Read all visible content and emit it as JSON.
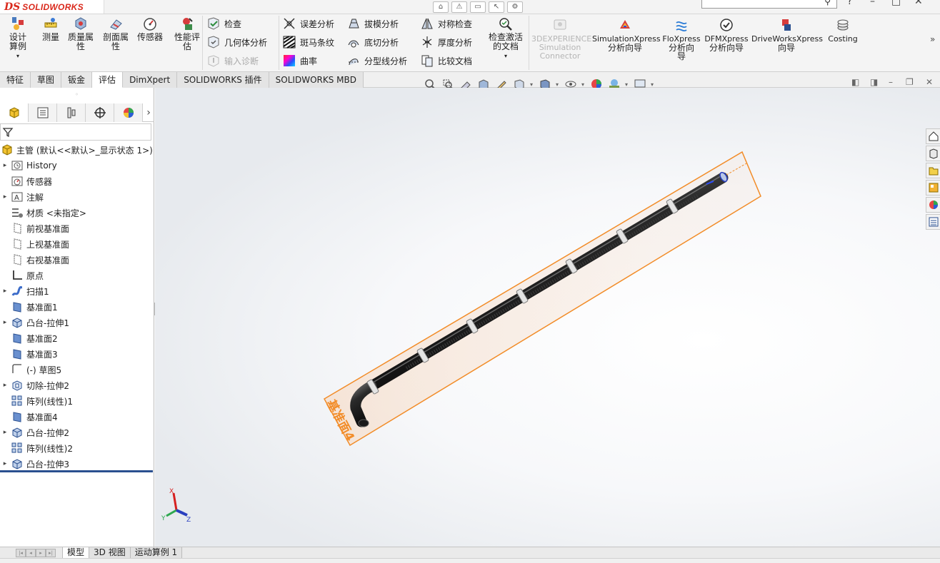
{
  "app": {
    "brand_mark": "DS",
    "brand_name": "SOLIDWORKS"
  },
  "ribbon": {
    "design_study": "设计算例",
    "measure": "测量",
    "mass_properties": "质量属性",
    "section_properties": "剖面属性",
    "sensors": "传感器",
    "performance_eval": "性能评估",
    "check": "检查",
    "geometry_analysis": "几何体分析",
    "import_diagnostics": "输入诊断",
    "deviation_analysis": "误差分析",
    "zebra_stripes": "斑马条纹",
    "curvature": "曲率",
    "draft_analysis": "拔模分析",
    "undercut_analysis": "底切分析",
    "parting_line_analysis": "分型线分析",
    "symmetry_check": "对称检查",
    "thickness_analysis": "厚度分析",
    "compare_documents": "比较文档",
    "check_active_doc": "检查激活的文档",
    "exp_line1": "3DEXPERIENCE",
    "exp_line2": "Simulation",
    "exp_line3": "Connector",
    "simxpress_1": "SimulationXpress",
    "simxpress_2": "分析向导",
    "floxpress_1": "FloXpress",
    "floxpress_2": "分析向",
    "floxpress_3": "导",
    "dfmxpress_1": "DFMXpress",
    "dfmxpress_2": "分析向导",
    "driveworks_1": "DriveWorksXpress",
    "driveworks_2": "向导",
    "costing": "Costing"
  },
  "tabs": [
    "特征",
    "草图",
    "钣金",
    "评估",
    "DimXpert",
    "SOLIDWORKS 插件",
    "SOLIDWORKS MBD"
  ],
  "active_tab": "评估",
  "feature_tree": {
    "root": "主管 (默认<<默认>_显示状态 1>)",
    "items": [
      {
        "label": "History",
        "expandable": true,
        "icon": "history-icon"
      },
      {
        "label": "传感器",
        "expandable": false,
        "icon": "sensor-icon"
      },
      {
        "label": "注解",
        "expandable": true,
        "icon": "annotation-icon"
      },
      {
        "label": "材质 <未指定>",
        "expandable": false,
        "icon": "material-icon"
      },
      {
        "label": "前视基准面",
        "expandable": false,
        "icon": "plane-icon"
      },
      {
        "label": "上视基准面",
        "expandable": false,
        "icon": "plane-icon"
      },
      {
        "label": "右视基准面",
        "expandable": false,
        "icon": "plane-icon"
      },
      {
        "label": "原点",
        "expandable": false,
        "icon": "origin-icon"
      },
      {
        "label": "扫描1",
        "expandable": true,
        "icon": "sweep-icon"
      },
      {
        "label": "基准面1",
        "expandable": false,
        "icon": "ref-plane-icon"
      },
      {
        "label": "凸台-拉伸1",
        "expandable": true,
        "icon": "extrude-icon"
      },
      {
        "label": "基准面2",
        "expandable": false,
        "icon": "ref-plane-icon"
      },
      {
        "label": "基准面3",
        "expandable": false,
        "icon": "ref-plane-icon"
      },
      {
        "label": "(-) 草图5",
        "expandable": false,
        "icon": "sketch-icon"
      },
      {
        "label": "切除-拉伸2",
        "expandable": true,
        "icon": "cut-extrude-icon"
      },
      {
        "label": "阵列(线性)1",
        "expandable": false,
        "icon": "pattern-icon"
      },
      {
        "label": "基准面4",
        "expandable": false,
        "icon": "ref-plane-icon"
      },
      {
        "label": "凸台-拉伸2",
        "expandable": true,
        "icon": "extrude-icon"
      },
      {
        "label": "阵列(线性)2",
        "expandable": false,
        "icon": "pattern-icon"
      },
      {
        "label": "凸台-拉伸3",
        "expandable": true,
        "icon": "extrude-icon"
      }
    ]
  },
  "viewport": {
    "plane_label": "基准面4",
    "plane_color": "#f28c28",
    "triad": {
      "x": "X",
      "y": "Y",
      "z": "Z"
    }
  },
  "bottom_tabs": [
    "模型",
    "3D 视图",
    "运动算例 1"
  ],
  "active_bottom_tab": "模型",
  "colors": {
    "accent_orange": "#f28c28",
    "rollback_bar": "#2a4f8f",
    "brand_red": "#da291c"
  }
}
